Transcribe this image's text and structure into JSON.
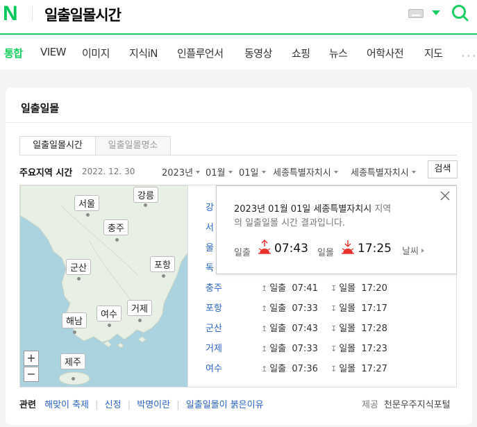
{
  "header": {
    "logo": "N",
    "query": "일출일몰시간"
  },
  "nav": {
    "items": [
      "통합",
      "VIEW",
      "이미지",
      "지식iN",
      "인플루언서",
      "동영상",
      "쇼핑",
      "뉴스",
      "어학사전",
      "지도"
    ],
    "more": "•••"
  },
  "card": {
    "title": "일출일몰",
    "tabs": [
      "일출일몰시간",
      "일출일몰명소"
    ],
    "section_title": "주요지역 시간",
    "section_date": "2022. 12. 30",
    "selects": {
      "year": "2023년",
      "month": "01월",
      "day": "01일",
      "province": "세종특별자치시",
      "city": "세종특별자치시"
    },
    "search_button": "검색"
  },
  "map": {
    "cities": [
      "서울",
      "강릉",
      "충주",
      "군산",
      "포항",
      "해남",
      "여수",
      "거제",
      "제주"
    ],
    "zoom_in": "+",
    "zoom_out": "−"
  },
  "list": {
    "hidden_rows": [
      "강",
      "서",
      "울",
      "독"
    ],
    "rise_label": "일출",
    "set_label": "일몰",
    "rows": [
      {
        "city": "충주",
        "rise": "07:41",
        "set": "17:20"
      },
      {
        "city": "포항",
        "rise": "07:33",
        "set": "17:17"
      },
      {
        "city": "군산",
        "rise": "07:43",
        "set": "17:28"
      },
      {
        "city": "거제",
        "rise": "07:33",
        "set": "17:23"
      },
      {
        "city": "여수",
        "rise": "07:36",
        "set": "17:27"
      }
    ]
  },
  "popup": {
    "date": "2023년 01월 01일",
    "region": "세종특별자치시",
    "suffix1": "지역",
    "line2": "의 일출일몰 시간 결과입니다.",
    "sunrise_label": "일출",
    "sunrise_time": "07:43",
    "sunset_label": "일몰",
    "sunset_time": "17:25",
    "weather_link": "날씨"
  },
  "related": {
    "label": "관련",
    "links": [
      "해맞이 축제",
      "신정",
      "박명이란",
      "일출일몰이 붉은이유"
    ]
  },
  "provider": {
    "label": "제공",
    "name": "천문우주지식포털"
  },
  "colors": {
    "naver_green": "#03c75a",
    "link_blue": "#2a64c8",
    "sun_red": "#e8302a"
  }
}
